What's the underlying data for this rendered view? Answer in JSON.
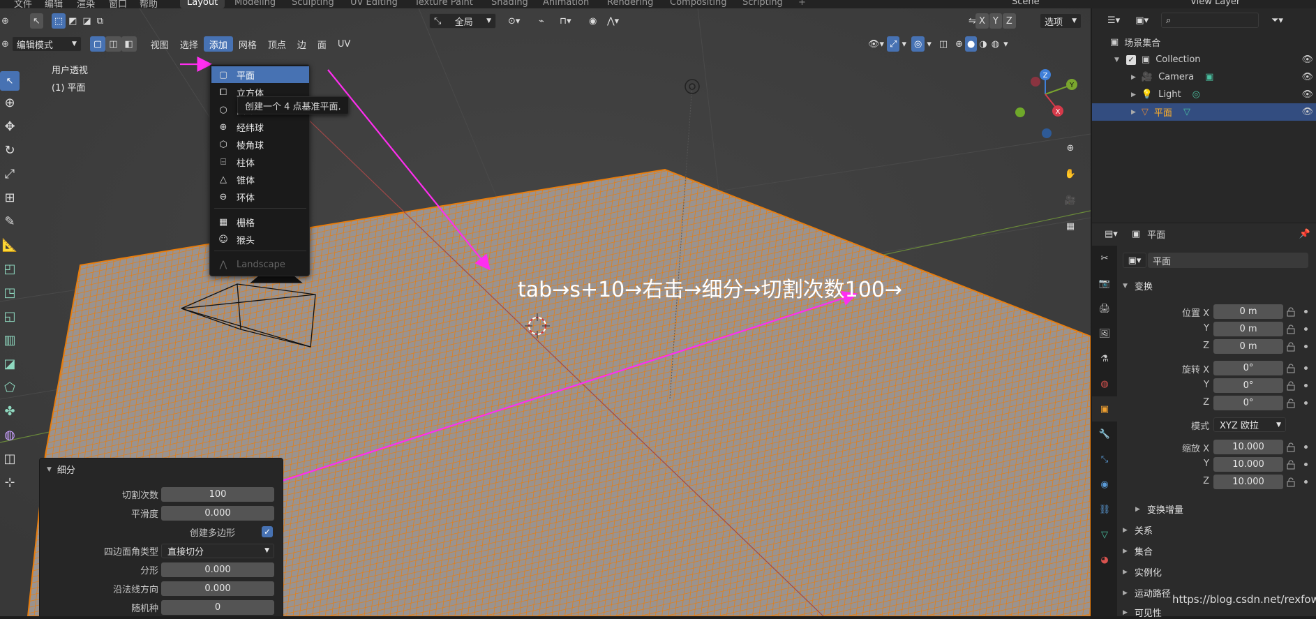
{
  "topbar": {
    "menus": [
      "文件",
      "编辑",
      "渲染",
      "窗口",
      "帮助"
    ],
    "workspaces": [
      "Layout",
      "Modeling",
      "Sculpting",
      "UV Editing",
      "Texture Paint",
      "Shading",
      "Animation",
      "Rendering",
      "Compositing",
      "Scripting"
    ],
    "active_workspace": "Layout",
    "scene": "Scene",
    "view_layer": "View Layer"
  },
  "header": {
    "mode": "编辑模式",
    "menus": [
      "视图",
      "选择",
      "添加",
      "网格",
      "顶点",
      "边",
      "面",
      "UV"
    ],
    "active_menu": "添加",
    "transform_orientation": "全局",
    "axes": [
      "X",
      "Y",
      "Z"
    ],
    "options": "选项"
  },
  "viewport": {
    "view_name": "用户透视",
    "object_label": "(1) 平面"
  },
  "add_menu": {
    "items": [
      {
        "label": "平面",
        "icon": "plane-icon",
        "highlighted": true
      },
      {
        "label": "立方体",
        "icon": "cube-icon"
      },
      {
        "label": "圆环",
        "icon": "circle-icon"
      },
      {
        "label": "经纬球",
        "icon": "uv-sphere-icon"
      },
      {
        "label": "棱角球",
        "icon": "ico-sphere-icon"
      },
      {
        "label": "柱体",
        "icon": "cylinder-icon"
      },
      {
        "label": "锥体",
        "icon": "cone-icon"
      },
      {
        "label": "环体",
        "icon": "torus-icon"
      },
      {
        "label": "栅格",
        "icon": "grid-icon"
      },
      {
        "label": "猴头",
        "icon": "monkey-icon"
      },
      {
        "label": "Landscape",
        "icon": "landscape-icon",
        "disabled": true
      }
    ],
    "tooltip": "创建一个 4 点基准平面."
  },
  "annotation": {
    "text": "tab→s+10→右击→细分→切割次数100→",
    "color": "#ff2ef0"
  },
  "redo_panel": {
    "title": "细分",
    "fields": [
      {
        "label": "切割次数",
        "value": "100"
      },
      {
        "label": "平滑度",
        "value": "0.000"
      },
      {
        "label": "四边面角类型",
        "value": "直接切分"
      },
      {
        "label": "分形",
        "value": "0.000"
      },
      {
        "label": "沿法线方向",
        "value": "0.000"
      },
      {
        "label": "随机种",
        "value": "0"
      }
    ],
    "checkbox_label": "创建多边形",
    "checkbox_checked": true
  },
  "outliner": {
    "root": "场景集合",
    "collection": "Collection",
    "objects": [
      {
        "name": "Camera",
        "color": "#e0883a"
      },
      {
        "name": "Light",
        "color": "#e0883a"
      },
      {
        "name": "平面",
        "color": "#e0883a",
        "selected": true
      }
    ]
  },
  "properties": {
    "header_title": "平面",
    "object_name": "平面",
    "transform_title": "变换",
    "location": {
      "label": "位置",
      "x": "0 m",
      "y": "0 m",
      "z": "0 m"
    },
    "rotation": {
      "label": "旋转",
      "x": "0°",
      "y": "0°",
      "z": "0°"
    },
    "mode_label": "模式",
    "mode_value": "XYZ 欧拉",
    "scale": {
      "label": "缩放",
      "x": "10.000",
      "y": "10.000",
      "z": "10.000"
    },
    "axis_labels": [
      "X",
      "Y",
      "Z"
    ],
    "delta_transform": "变换增量",
    "sections": [
      "关系",
      "集合",
      "实例化",
      "运动路径",
      "可见性"
    ]
  },
  "watermark": "https://blog.csdn.net/rexfow",
  "colors": {
    "accent": "#4772b3",
    "mesh_orange": "#e87d0d",
    "viewport_bg": "#3d3d3d",
    "panel_bg": "#282828"
  }
}
